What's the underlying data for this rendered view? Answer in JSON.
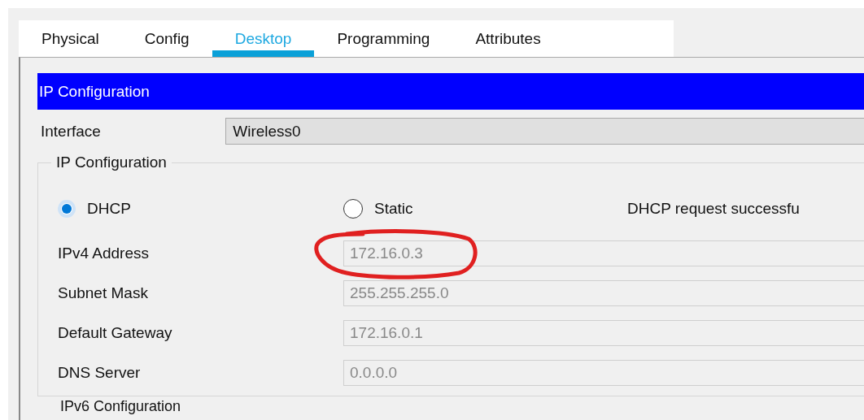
{
  "tabs": [
    {
      "label": "Physical",
      "selected": false
    },
    {
      "label": "Config",
      "selected": false
    },
    {
      "label": "Desktop",
      "selected": true
    },
    {
      "label": "Programming",
      "selected": false
    },
    {
      "label": "Attributes",
      "selected": false
    }
  ],
  "header": "IP Configuration",
  "interface": {
    "label": "Interface",
    "value": "Wireless0"
  },
  "ipv4_section": {
    "legend": "IP Configuration",
    "modes": [
      {
        "label": "DHCP",
        "selected": true
      },
      {
        "label": "Static",
        "selected": false
      }
    ],
    "status": "DHCP request successfu",
    "fields": [
      {
        "label": "IPv4 Address",
        "value": "172.16.0.3",
        "circled": true
      },
      {
        "label": "Subnet Mask",
        "value": "255.255.255.0",
        "circled": false
      },
      {
        "label": "Default Gateway",
        "value": "172.16.0.1",
        "circled": false
      },
      {
        "label": "DNS Server",
        "value": "0.0.0.0",
        "circled": false
      }
    ]
  },
  "ipv6_section": {
    "legend": "IPv6 Configuration"
  }
}
